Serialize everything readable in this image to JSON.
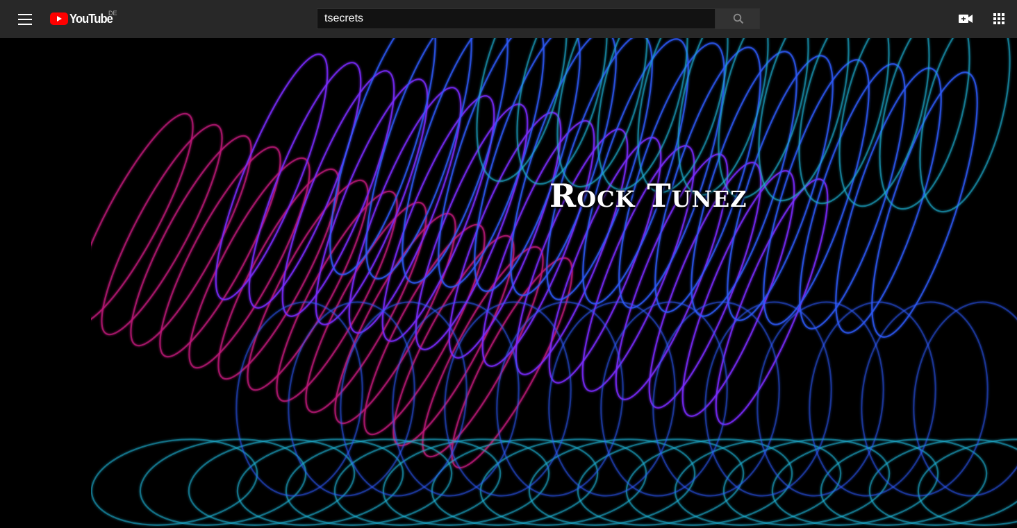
{
  "masthead": {
    "menu_icon": "hamburger-menu-icon",
    "logo_text": "YouTube",
    "country_code": "DE",
    "search_value": "tsecrets",
    "search_icon": "search-icon",
    "create_icon": "video-camera-plus-icon",
    "apps_icon": "apps-grid-icon"
  },
  "banner": {
    "title": "Rock Tunez",
    "colors": {
      "magenta": "#c0197a",
      "purple": "#7a2cff",
      "blue": "#2f5cff",
      "cyan": "#1fb3d6"
    }
  }
}
